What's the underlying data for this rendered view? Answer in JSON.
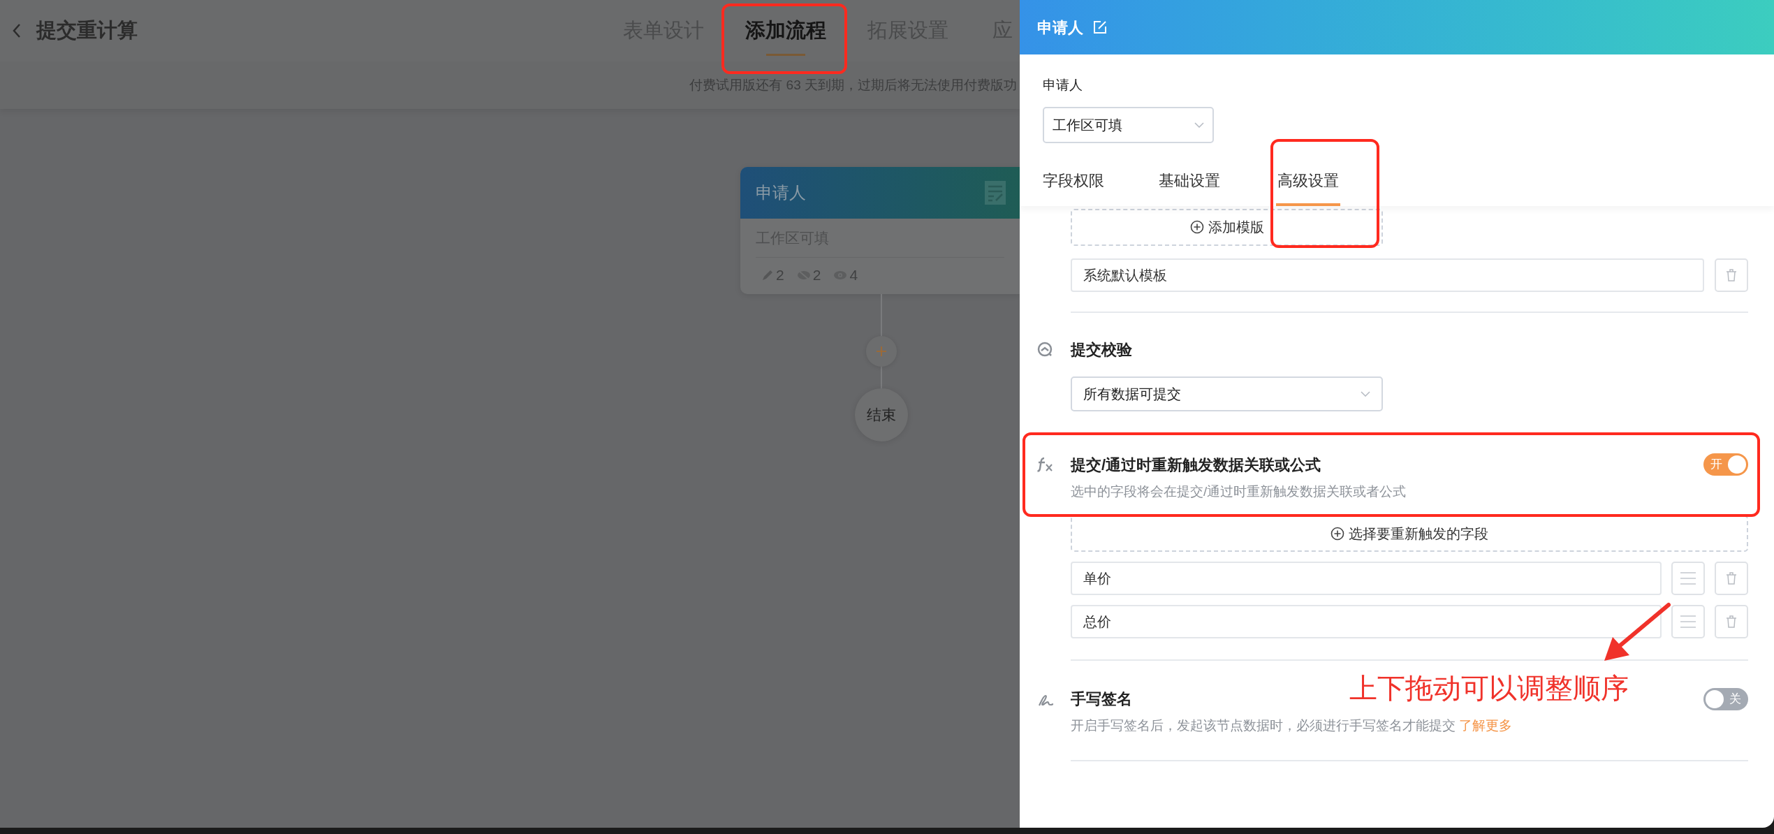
{
  "page": {
    "title": "提交重计算",
    "tabs": [
      {
        "label": "表单设计",
        "selected": false,
        "highlighted": false
      },
      {
        "label": "添加流程",
        "selected": true,
        "highlighted": true
      },
      {
        "label": "拓展设置",
        "selected": false,
        "highlighted": false
      },
      {
        "label": "应",
        "selected": false,
        "highlighted": false
      }
    ],
    "notice": "付费试用版还有 63 天到期，过期后将无法使用付费版功"
  },
  "flow": {
    "nodes": [
      {
        "kind": "approver",
        "title": "申请人",
        "subtitle": "工作区可填",
        "counts": [
          {
            "kind": "edit",
            "value": "2"
          },
          {
            "kind": "hidden",
            "value": "2"
          },
          {
            "kind": "visible",
            "value": "4"
          }
        ]
      },
      {
        "kind": "add"
      },
      {
        "kind": "end",
        "title": "结束"
      }
    ]
  },
  "drawer": {
    "title": "申请人",
    "node_label": "申请人",
    "permission_select": "工作区可填",
    "tabs": [
      {
        "label": "字段权限",
        "selected": false,
        "highlighted": false
      },
      {
        "label": "基础设置",
        "selected": false,
        "highlighted": false
      },
      {
        "label": "高级设置",
        "selected": true,
        "highlighted": true
      }
    ],
    "template_add_button": "添加模版",
    "templates": [
      "系统默认模板"
    ],
    "sections": [
      {
        "kind": "select",
        "title": "提交校验",
        "value": "所有数据可提交"
      },
      {
        "kind": "fields",
        "title": "提交/通过时重新触发数据关联或公式",
        "description": "选中的字段将会在提交/通过时重新触发数据关联或者公式",
        "on": true,
        "toggle_label": "开",
        "highlighted": true,
        "add_button": "选择要重新触发的字段",
        "fields": [
          "单价",
          "总价"
        ]
      },
      {
        "kind": "toggle",
        "title": "手写签名",
        "description": "开启手写签名后，发起该节点数据时，必须进行手写签名才能提交",
        "link": "了解更多",
        "on": false,
        "toggle_label": "关",
        "highlighted": false
      }
    ]
  },
  "annotation": {
    "text": "上下拖动可以调整顺序"
  }
}
